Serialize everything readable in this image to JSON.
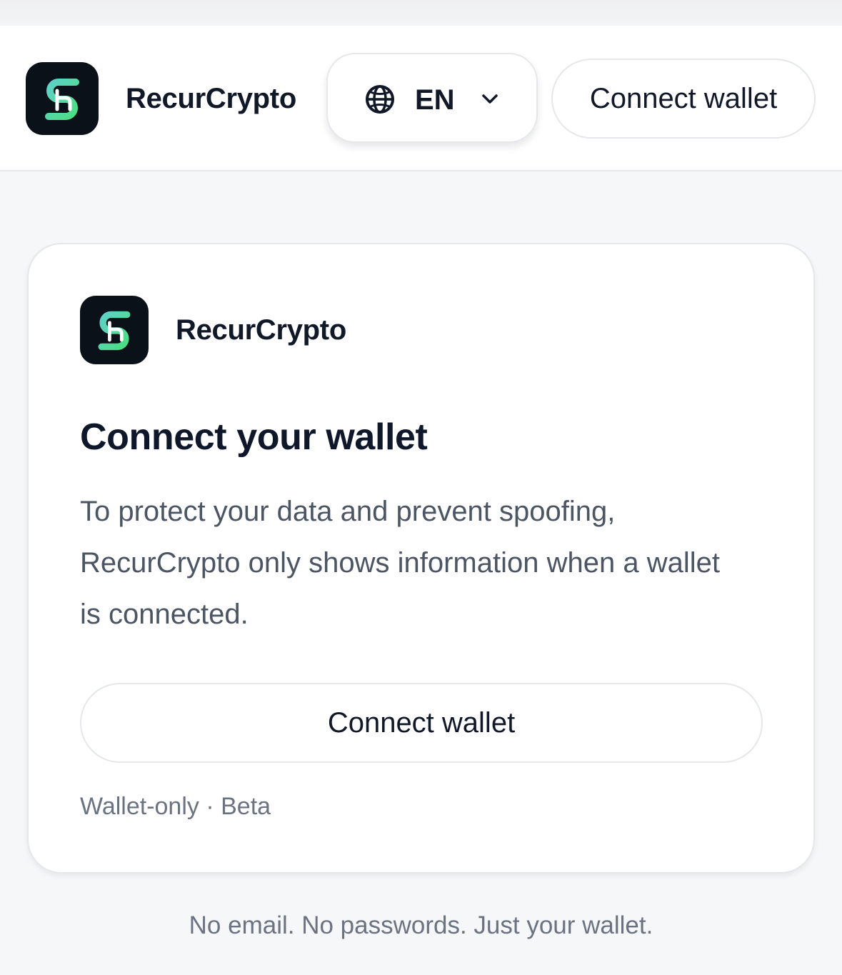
{
  "header": {
    "brand_name": "RecurCrypto",
    "language": {
      "label": "EN",
      "icon": "globe-icon",
      "dropdown_icon": "chevron-down-icon"
    },
    "connect_button_label": "Connect wallet"
  },
  "card": {
    "brand_name": "RecurCrypto",
    "title": "Connect your wallet",
    "description": "To protect your data and prevent spoofing, RecurCrypto only shows information when a wallet is connected.",
    "connect_button_label": "Connect wallet",
    "meta": "Wallet-only · Beta"
  },
  "footer": {
    "note": "No email. No passwords. Just your wallet."
  },
  "colors": {
    "logo_background": "#0b1118",
    "logo_accent_teal": "#5fd1c8",
    "logo_accent_green": "#4ade80",
    "page_background": "#f6f7f9",
    "border": "#e5e7eb"
  }
}
